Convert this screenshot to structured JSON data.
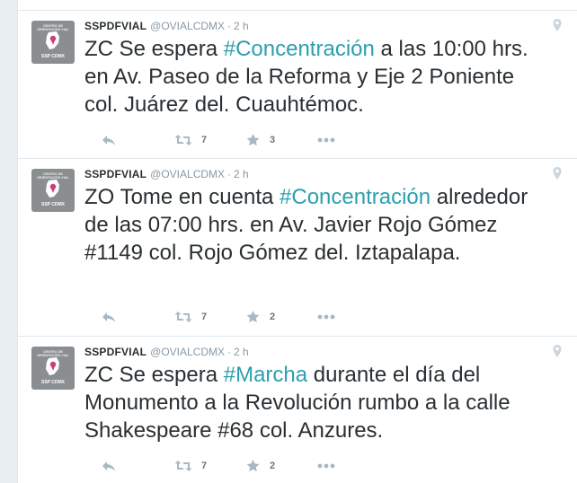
{
  "tweets": [
    {
      "account": {
        "display_name": "SSPDFVIAL",
        "handle": "@OVIALCDMX",
        "separator": "·",
        "time": "2 h",
        "avatar_top_text": "CENTRO DE ORIENTACIÓN VIAL",
        "avatar_bottom_text": "SSP CDMX"
      },
      "text_before": "ZC Se espera ",
      "hashtag": "#Concentración",
      "text_after": " a las 10:00 hrs. en Av. Paseo de la Reforma y Eje 2 Poniente col. Juárez del. Cuauhtémoc.",
      "retweets": "7",
      "favorites": "3"
    },
    {
      "account": {
        "display_name": "SSPDFVIAL",
        "handle": "@OVIALCDMX",
        "separator": "·",
        "time": "2 h",
        "avatar_top_text": "CENTRO DE ORIENTACIÓN VIAL",
        "avatar_bottom_text": "SSP CDMX"
      },
      "text_before": "ZO Tome en cuenta ",
      "hashtag": "#Concentración",
      "text_after": " alrededor de las 07:00 hrs. en Av. Javier Rojo Gómez #1149 col. Rojo Gómez del. Iztapalapa.",
      "retweets": "7",
      "favorites": "2"
    },
    {
      "account": {
        "display_name": "SSPDFVIAL",
        "handle": "@OVIALCDMX",
        "separator": "·",
        "time": "2 h",
        "avatar_top_text": "CENTRO DE ORIENTACIÓN VIAL",
        "avatar_bottom_text": "SSP CDMX"
      },
      "text_before": "ZC Se espera ",
      "hashtag": "#Marcha",
      "text_after": " durante el día del Monumento a la Revolución rumbo a la calle Shakespeare #68 col. Anzures.",
      "retweets": "7",
      "favorites": "2"
    }
  ],
  "icons": {
    "reply": "reply-icon",
    "retweet": "retweet-icon",
    "favorite": "star-icon",
    "more": "more-icon",
    "location": "location-pin-icon",
    "avatar": "avatar-map-icon"
  },
  "colors": {
    "hashtag": "#2b9fae",
    "action_icon": "#aab8c2",
    "muted_text": "#8899a6",
    "body_text": "#292f33",
    "avatar_bg": "#8a8e91",
    "avatar_pin": "#cf3b7a"
  }
}
